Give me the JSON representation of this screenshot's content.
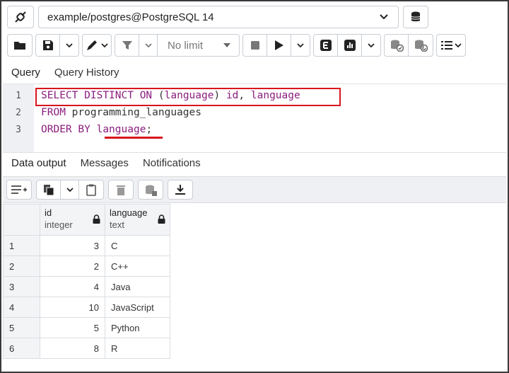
{
  "connection": {
    "name": "example/postgres@PostgreSQL 14",
    "icon": "connection-plug-icon",
    "db_icon": "database-icon"
  },
  "toolbar": {
    "limit_label": "No limit",
    "icons": [
      "open-folder-icon",
      "save-icon",
      "pen-icon",
      "filter-icon",
      "stop-icon",
      "execute-icon",
      "explain-icon",
      "explain-analyze-icon",
      "commit-icon",
      "rollback-icon",
      "macros-icon"
    ]
  },
  "query_tabs": {
    "query": "Query",
    "history": "Query History"
  },
  "editor": {
    "lines": [
      {
        "num": "1",
        "tokens": [
          {
            "t": "SELECT",
            "c": "kw"
          },
          {
            "t": " ",
            "c": "id"
          },
          {
            "t": "DISTINCT",
            "c": "kw"
          },
          {
            "t": " ",
            "c": "id"
          },
          {
            "t": "ON",
            "c": "kw"
          },
          {
            "t": " (",
            "c": "id"
          },
          {
            "t": "language",
            "c": "kw"
          },
          {
            "t": ") ",
            "c": "id"
          },
          {
            "t": "id",
            "c": "kw"
          },
          {
            "t": ", ",
            "c": "id"
          },
          {
            "t": "language",
            "c": "kw"
          }
        ]
      },
      {
        "num": "2",
        "tokens": [
          {
            "t": "FROM",
            "c": "kw"
          },
          {
            "t": " programming_languages",
            "c": "id"
          }
        ]
      },
      {
        "num": "3",
        "tokens": [
          {
            "t": "ORDER",
            "c": "kw"
          },
          {
            "t": " ",
            "c": "id"
          },
          {
            "t": "BY",
            "c": "kw"
          },
          {
            "t": " ",
            "c": "id"
          },
          {
            "t": "language",
            "c": "kw"
          },
          {
            "t": ";",
            "c": "id"
          }
        ]
      }
    ],
    "highlight_color": "#d8141c"
  },
  "output_tabs": {
    "data_output": "Data output",
    "messages": "Messages",
    "notifications": "Notifications"
  },
  "output_toolbar": {
    "icons": [
      "add-row-icon",
      "copy-icon",
      "paste-icon",
      "delete-icon",
      "save-data-icon",
      "download-icon"
    ]
  },
  "grid": {
    "columns": [
      {
        "name": "id",
        "type": "integer"
      },
      {
        "name": "language",
        "type": "text"
      }
    ],
    "rows": [
      {
        "num": "1",
        "id": "3",
        "language": "C"
      },
      {
        "num": "2",
        "id": "2",
        "language": "C++"
      },
      {
        "num": "3",
        "id": "4",
        "language": "Java"
      },
      {
        "num": "4",
        "id": "10",
        "language": "JavaScript"
      },
      {
        "num": "5",
        "id": "5",
        "language": "Python"
      },
      {
        "num": "6",
        "id": "8",
        "language": "R"
      }
    ]
  }
}
